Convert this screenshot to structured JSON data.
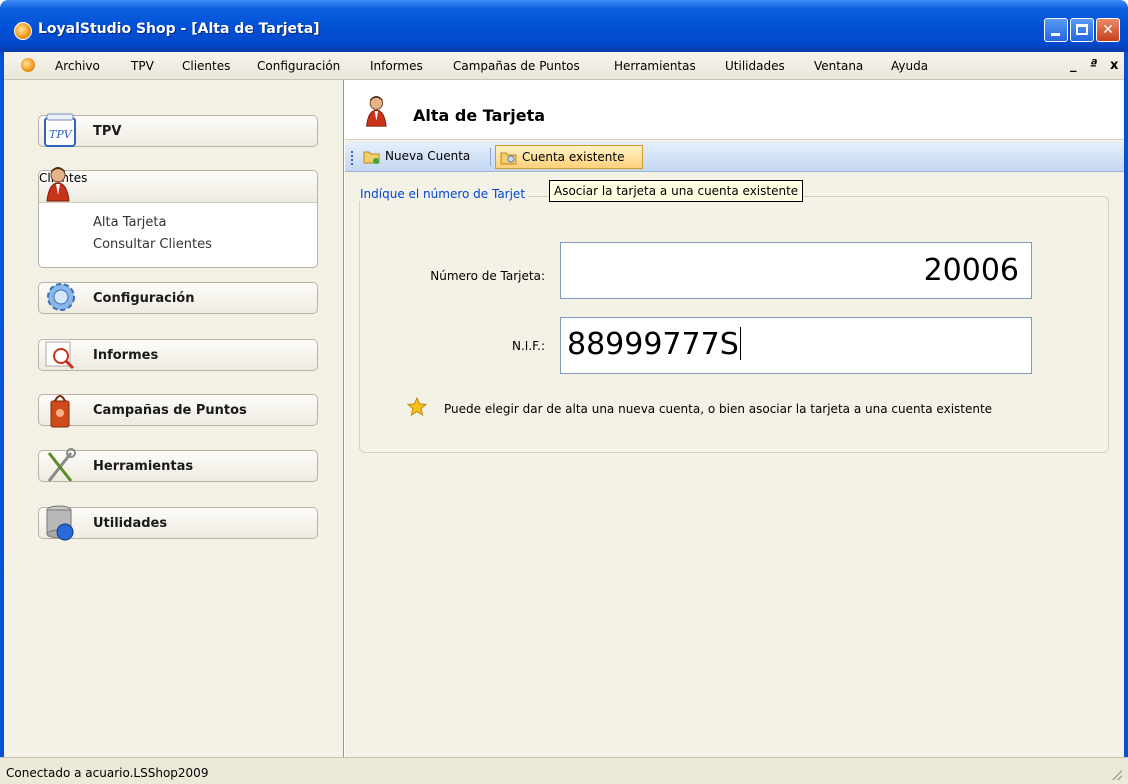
{
  "window": {
    "title": "LoyalStudio Shop - [Alta de Tarjeta]"
  },
  "menubar": {
    "items": [
      "Archivo",
      "TPV",
      "Clientes",
      "Configuración",
      "Informes",
      "Campañas de Puntos",
      "Herramientas",
      "Utilidades",
      "Ventana",
      "Ayuda"
    ],
    "mdi_min": "_",
    "mdi_restore": "ª",
    "mdi_close": "x"
  },
  "sidebar": {
    "tpv": "TPV",
    "clientes": "Clientes",
    "clientes_links": [
      "Alta Tarjeta",
      "Consultar Clientes"
    ],
    "configuracion": "Configuración",
    "informes": "Informes",
    "campanas": "Campañas de Puntos",
    "herramientas": "Herramientas",
    "utilidades": "Utilidades"
  },
  "page": {
    "title": "Alta de Tarjeta"
  },
  "toolbar": {
    "nueva_cuenta": "Nueva Cuenta",
    "cuenta_existente": "Cuenta existente"
  },
  "tooltip": "Asociar la tarjeta a una cuenta existente",
  "form": {
    "legend": "Indíque el número de Tarjet",
    "numero_label": "Número de Tarjeta:",
    "numero_value": "20006",
    "nif_label": "N.I.F.:",
    "nif_value": "88999777S",
    "info": "Puede elegir dar de alta una nueva cuenta, o bien asociar la tarjeta a una cuenta existente"
  },
  "statusbar": {
    "text": "Conectado a acuario.LSShop2009"
  },
  "colors": {
    "titlebar": "#0351d6",
    "legend": "#0046d5",
    "tooltip_bg": "#ffffe1",
    "toolbar_hover": "#ffd17a"
  }
}
